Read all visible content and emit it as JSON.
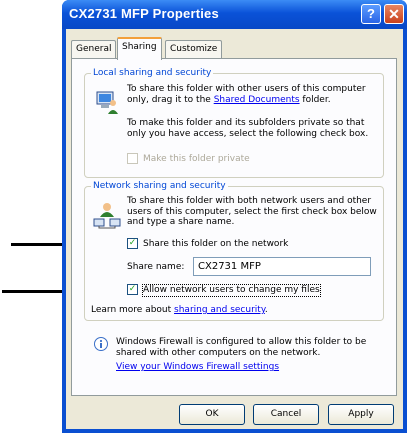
{
  "window": {
    "title": "CX2731 MFP Properties",
    "help_label": "?",
    "close_label": "✕"
  },
  "tabs": [
    {
      "label": "General"
    },
    {
      "label": "Sharing"
    },
    {
      "label": "Customize"
    }
  ],
  "local": {
    "legend": "Local sharing and security",
    "text1_pre": "To share this folder with other users of this computer only, drag it to the ",
    "text1_link": "Shared Documents",
    "text1_post": " folder.",
    "text2": "To make this folder and its subfolders private so that only you have access, select the following check box.",
    "private_label": "Make this folder private",
    "private_checked": false
  },
  "network": {
    "legend": "Network sharing and security",
    "text": "To share this folder with both network users and other users of this computer, select the first check box below and type a share name.",
    "share_label": "Share this folder on the network",
    "share_checked": true,
    "share_name_label": "Share name:",
    "share_name_value": "CX2731 MFP",
    "allow_label": "Allow network users to change my files",
    "allow_checked": true,
    "learn_pre": "Learn more about ",
    "learn_link": "sharing and security",
    "learn_post": "."
  },
  "firewall": {
    "text": "Windows Firewall is configured to allow this folder to be shared with other computers on the network.",
    "link": "View your Windows Firewall settings"
  },
  "buttons": {
    "ok": "OK",
    "cancel": "Cancel",
    "apply": "Apply"
  },
  "icons": {
    "local_sharing": "computer-users-icon",
    "network_sharing": "network-share-icon",
    "firewall": "info-icon"
  }
}
